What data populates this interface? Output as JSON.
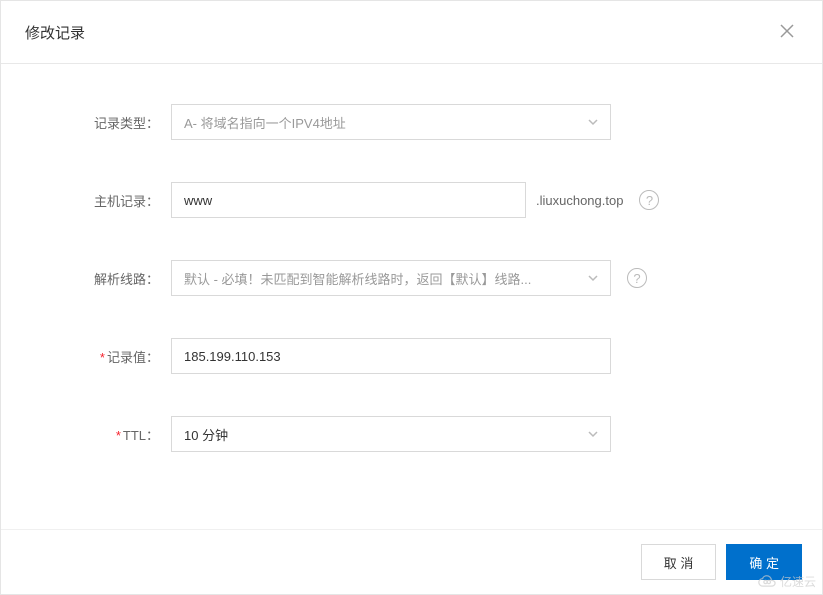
{
  "modal": {
    "title": "修改记录",
    "close_label": "Close"
  },
  "form": {
    "record_type": {
      "label": "记录类型：",
      "value": "A- 将域名指向一个IPV4地址"
    },
    "host_record": {
      "label": "主机记录：",
      "value": "www",
      "suffix": ".liuxuchong.top",
      "help": "?"
    },
    "route": {
      "label": "解析线路：",
      "value": "默认 - 必填！未匹配到智能解析线路时，返回【默认】线路...",
      "help": "?"
    },
    "record_value": {
      "label": "记录值：",
      "value": "185.199.110.153"
    },
    "ttl": {
      "label": "TTL：",
      "value": "10 分钟"
    }
  },
  "footer": {
    "cancel": "取 消",
    "confirm": "确 定"
  },
  "watermark": {
    "text": "亿速云"
  }
}
